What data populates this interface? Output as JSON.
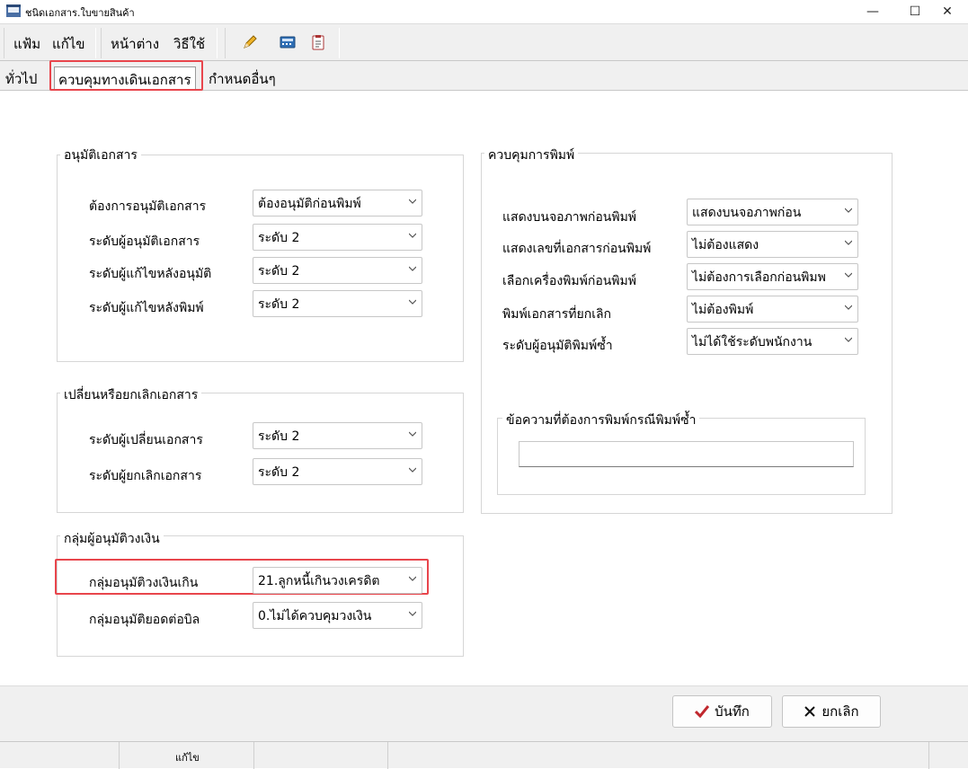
{
  "window": {
    "title": "ชนิดเอกสาร.ใบขายสินค้า",
    "minimize": "—",
    "maximize": "☐",
    "close": "✕"
  },
  "menu": {
    "file": "แฟ้ม",
    "edit": "แก้ไข",
    "window": "หน้าต่าง",
    "help": "วิธีใช้"
  },
  "toolbar": {
    "icons": [
      "pencil-icon",
      "calculator-icon",
      "clipboard-icon"
    ]
  },
  "tabs": [
    {
      "label": "ทั่วไป",
      "active": false
    },
    {
      "label": "ควบคุมทางเดินเอกสาร",
      "active": true
    },
    {
      "label": "กำหนดอื่นๆ",
      "active": false
    }
  ],
  "approval": {
    "title": "อนุมัติเอกสาร",
    "rows": [
      {
        "label": "ต้องการอนุมัติเอกสาร",
        "value": "ต้องอนุมัติก่อนพิมพ์"
      },
      {
        "label": "ระดับผู้อนุมัติเอกสาร",
        "value": "ระดับ 2"
      },
      {
        "label": "ระดับผู้แก้ไขหลังอนุมัติ",
        "value": "ระดับ 2"
      },
      {
        "label": "ระดับผู้แก้ไขหลังพิมพ์",
        "value": "ระดับ 2"
      }
    ]
  },
  "change_cancel": {
    "title": "เปลี่ยนหรือยกเลิกเอกสาร",
    "rows": [
      {
        "label": "ระดับผู้เปลี่ยนเอกสาร",
        "value": "ระดับ 2"
      },
      {
        "label": "ระดับผู้ยกเลิกเอกสาร",
        "value": "ระดับ 2"
      }
    ]
  },
  "credit_group": {
    "title": "กลุ่มผู้อนุมัติวงเงิน",
    "rows": [
      {
        "label": "กลุ่มอนุมัติวงเงินเกิน",
        "value": "21.ลูกหนี้เกินวงเครดิต"
      },
      {
        "label": "กลุ่มอนุมัติยอดต่อบิล",
        "value": "0.ไม่ได้ควบคุมวงเงิน"
      }
    ]
  },
  "print_control": {
    "title": "ควบคุมการพิมพ์",
    "rows": [
      {
        "label": "แสดงบนจอภาพก่อนพิมพ์",
        "value": "แสดงบนจอภาพก่อน"
      },
      {
        "label": "แสดงเลขที่เอกสารก่อนพิมพ์",
        "value": "ไม่ต้องแสดง"
      },
      {
        "label": "เลือกเครื่องพิมพ์ก่อนพิมพ์",
        "value": "ไม่ต้องการเลือกก่อนพิมพ"
      },
      {
        "label": "พิมพ์เอกสารที่ยกเลิก",
        "value": "ไม่ต้องพิมพ์"
      },
      {
        "label": "ระดับผู้อนุมัติพิมพ์ซ้ำ",
        "value": "ไม่ได้ใช้ระดับพนักงาน"
      }
    ],
    "reprint_message": {
      "title": "ข้อความที่ต้องการพิมพ์กรณีพิมพ์ซ้ำ",
      "value": ""
    }
  },
  "buttons": {
    "save": "บันทึก",
    "cancel": "ยกเลิก"
  },
  "status": {
    "mode": "แก้ไข"
  },
  "colors": {
    "highlight": "#e8454c",
    "save_check": "#c0272d"
  }
}
